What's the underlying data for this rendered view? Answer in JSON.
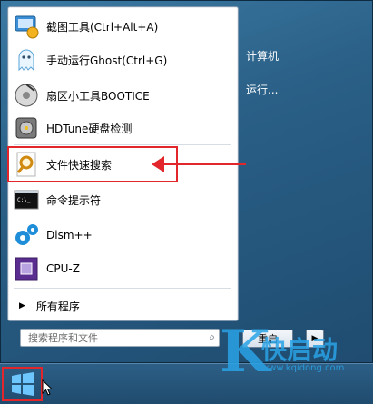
{
  "programs": [
    {
      "label": "截图工具(Ctrl+Alt+A)",
      "icon": "screenshot-tool-icon"
    },
    {
      "label": "手动运行Ghost(Ctrl+G)",
      "icon": "ghost-icon"
    },
    {
      "label": "扇区小工具BOOTICE",
      "icon": "bootice-icon"
    },
    {
      "label": "HDTune硬盘检测",
      "icon": "hard-disk-icon"
    },
    {
      "label": "文件快速搜索",
      "icon": "magnifier-icon"
    },
    {
      "label": "命令提示符",
      "icon": "command-prompt-icon"
    },
    {
      "label": "Dism++",
      "icon": "gears-icon"
    },
    {
      "label": "CPU-Z",
      "icon": "cpu-icon"
    }
  ],
  "all_programs_label": "所有程序",
  "search": {
    "placeholder": "搜索程序和文件"
  },
  "right_panel": {
    "computer": "计算机",
    "run": "运行..."
  },
  "shutdown_label": "重启",
  "watermark": {
    "letter": "K",
    "text": "快启动",
    "url": "www.kqidong.com"
  },
  "colors": {
    "highlight": "#e2262c",
    "accent": "#2aa3e6"
  }
}
